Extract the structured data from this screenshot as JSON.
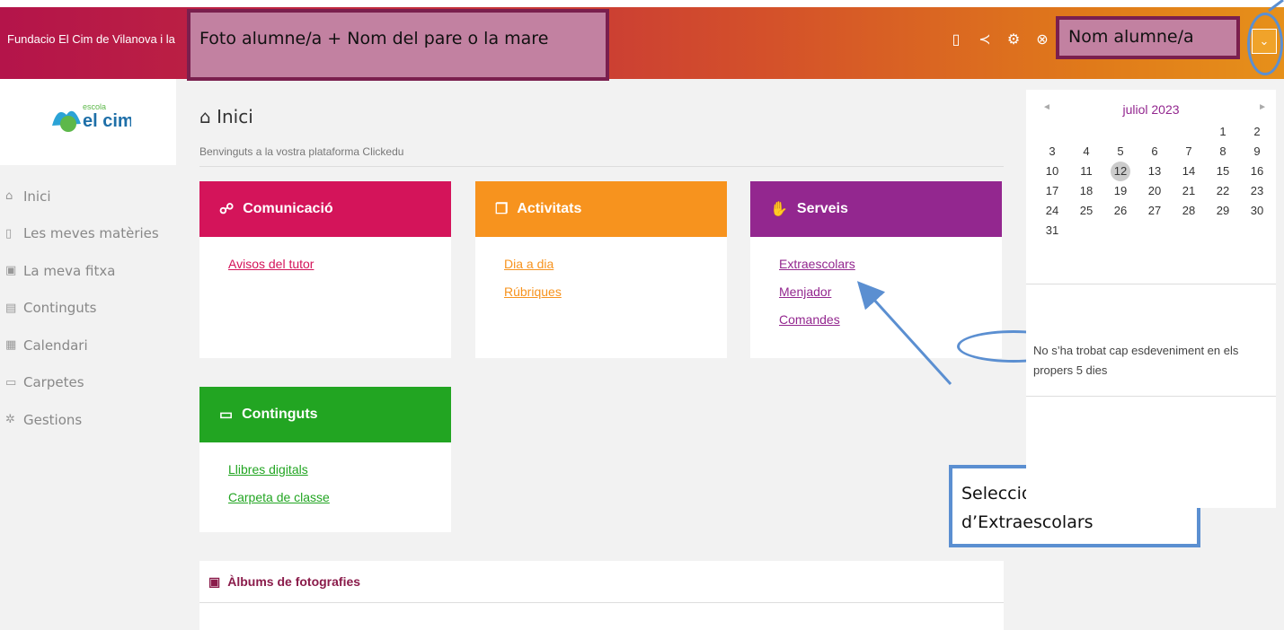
{
  "header": {
    "org_name": "Fundacio El Cim de Vilanova i la Geltrú",
    "parent_note": "Foto alumne/a + Nom del pare o la mare",
    "student_note": "Nom alumne/a",
    "icons": [
      "mobile-icon",
      "share-icon",
      "settings-icon",
      "close-circle-icon"
    ]
  },
  "sidebar": {
    "logo_small": "escola",
    "logo_big": "el cim",
    "items": [
      {
        "label": "Inici",
        "icon": "⌂"
      },
      {
        "label": "Les meves matèries",
        "icon": "▯"
      },
      {
        "label": "La meva fitxa",
        "icon": "▣"
      },
      {
        "label": "Continguts",
        "icon": "▤"
      },
      {
        "label": "Calendari",
        "icon": "▦"
      },
      {
        "label": "Carpetes",
        "icon": "▭"
      },
      {
        "label": "Gestions",
        "icon": "✲"
      }
    ]
  },
  "main": {
    "title": "Inici",
    "subtitle": "Benvinguts a la vostra plataforma Clickedu",
    "cards": {
      "comunicacio": {
        "title": "Comunicació",
        "links": [
          "Avisos del tutor"
        ]
      },
      "activitats": {
        "title": "Activitats",
        "links": [
          "Dia a dia",
          "Rúbriques"
        ]
      },
      "serveis": {
        "title": "Serveis",
        "links": [
          "Extraescolars",
          "Menjador",
          "Comandes"
        ]
      },
      "continguts": {
        "title": "Continguts",
        "links": [
          "Llibres digitals",
          "Carpeta de classe"
        ]
      }
    },
    "albums_title": "Àlbums de fotografies",
    "service_note": "Seleccioneu el Servei\nd’Extraescolars"
  },
  "calendar": {
    "month": "juliol 2023",
    "prev": "◄",
    "next": "►",
    "today": 12,
    "leading_blanks": 5,
    "days": 31,
    "empty_message": "No s’ha trobat cap esdeveniment en els propers 5 dies"
  },
  "colors": {
    "comunicacio": "#d4145a",
    "activitats": "#f7931e",
    "serveis": "#93278f",
    "continguts": "#22a522",
    "annotation": "#5b8fd1",
    "note_fill": "#c281a1"
  }
}
